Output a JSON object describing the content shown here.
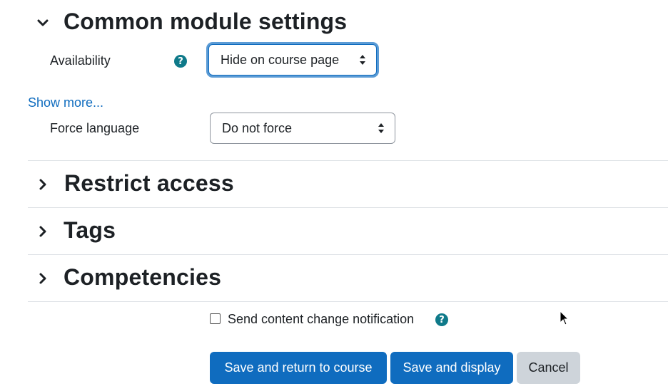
{
  "sections": {
    "common": {
      "title": "Common module settings",
      "expanded": true
    },
    "restrict": {
      "title": "Restrict access",
      "expanded": false
    },
    "tags": {
      "title": "Tags",
      "expanded": false
    },
    "competencies": {
      "title": "Competencies",
      "expanded": false
    }
  },
  "availability": {
    "label": "Availability",
    "help_icon": "question-circle-icon",
    "value": "Hide on course page"
  },
  "show_more": "Show more...",
  "force_language": {
    "label": "Force language",
    "value": "Do not force"
  },
  "notification": {
    "label": "Send content change notification",
    "checked": false,
    "help_icon": "question-circle-icon"
  },
  "buttons": {
    "save_return": "Save and return to course",
    "save_display": "Save and display",
    "cancel": "Cancel"
  },
  "colors": {
    "primary": "#0f6cbf",
    "help": "#0f7a8a",
    "text": "#1d2125",
    "secondary": "#ced4da"
  }
}
